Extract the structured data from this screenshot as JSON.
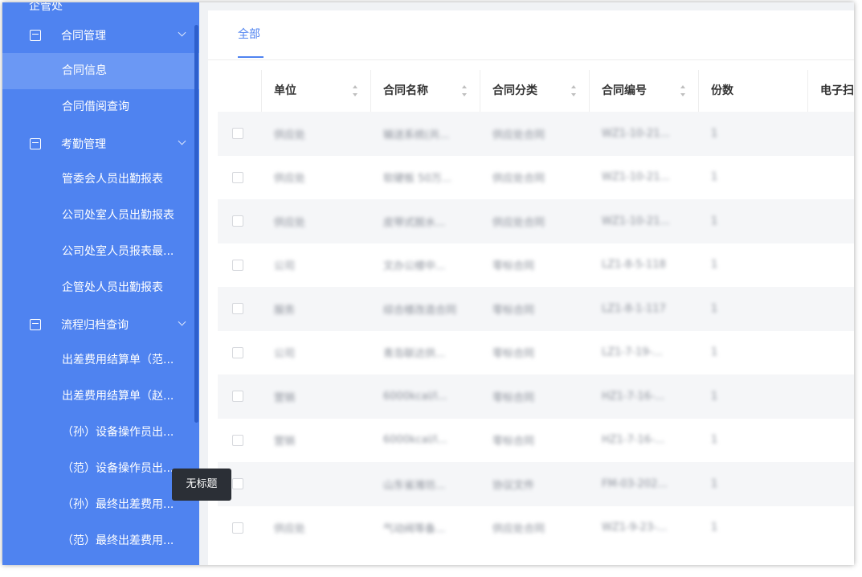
{
  "sidebar": {
    "title": "企管处",
    "groups": [
      {
        "label": "合同管理",
        "items": [
          "合同信息",
          "合同借阅查询"
        ]
      },
      {
        "label": "考勤管理",
        "items": [
          "管委会人员出勤报表",
          "公司处室人员出勤报表",
          "公司处室人员报表最...",
          "企管处人员出勤报表"
        ]
      },
      {
        "label": "流程归档查询",
        "items": [
          "出差费用结算单（范...",
          "出差费用结算单（赵...",
          "（孙）设备操作员出...",
          "（范）设备操作员出...",
          "（孙）最终出差费用...",
          "（范）最终出差费用..."
        ]
      }
    ],
    "active_item": "合同信息"
  },
  "tooltip": {
    "text": "无标题"
  },
  "tabs": [
    {
      "label": "全部",
      "active": true
    }
  ],
  "table": {
    "columns": [
      "单位",
      "合同名称",
      "合同分类",
      "合同编号",
      "份数",
      "电子扫"
    ],
    "rows": [
      [
        "供应处",
        "输送系统(共...",
        "供应处合同",
        "WZ1-10-21...",
        "1"
      ],
      [
        "供应处",
        "软硬板 50万...",
        "供应处合同",
        "WZ1-10-21...",
        "1"
      ],
      [
        "供应处",
        "皮带式脱水...",
        "供应处合同",
        "WZ1-10-21...",
        "1"
      ],
      [
        "公司",
        "文办公楼中...",
        "零标合同",
        "LZ1-8-5-118",
        "1"
      ],
      [
        "服务",
        "综合楼改造合同",
        "零标合同",
        "LZ1-8-1-117",
        "1"
      ],
      [
        "公司",
        "青岛联达供...",
        "零标合同",
        "LZ1-7-19-...",
        "1"
      ],
      [
        "营销",
        "6000kcal/l...",
        "零标合同",
        "HZ1-7-16-...",
        "1"
      ],
      [
        "营销",
        "6000kcal/l...",
        "零标合同",
        "HZ1-7-16-...",
        "1"
      ],
      [
        "",
        "山东省潍坊...",
        "协议文件",
        "FM-03-202...",
        "1"
      ],
      [
        "供应处",
        "气动阀等备...",
        "供应处合同",
        "WZ1-9-23-...",
        "1"
      ]
    ]
  }
}
